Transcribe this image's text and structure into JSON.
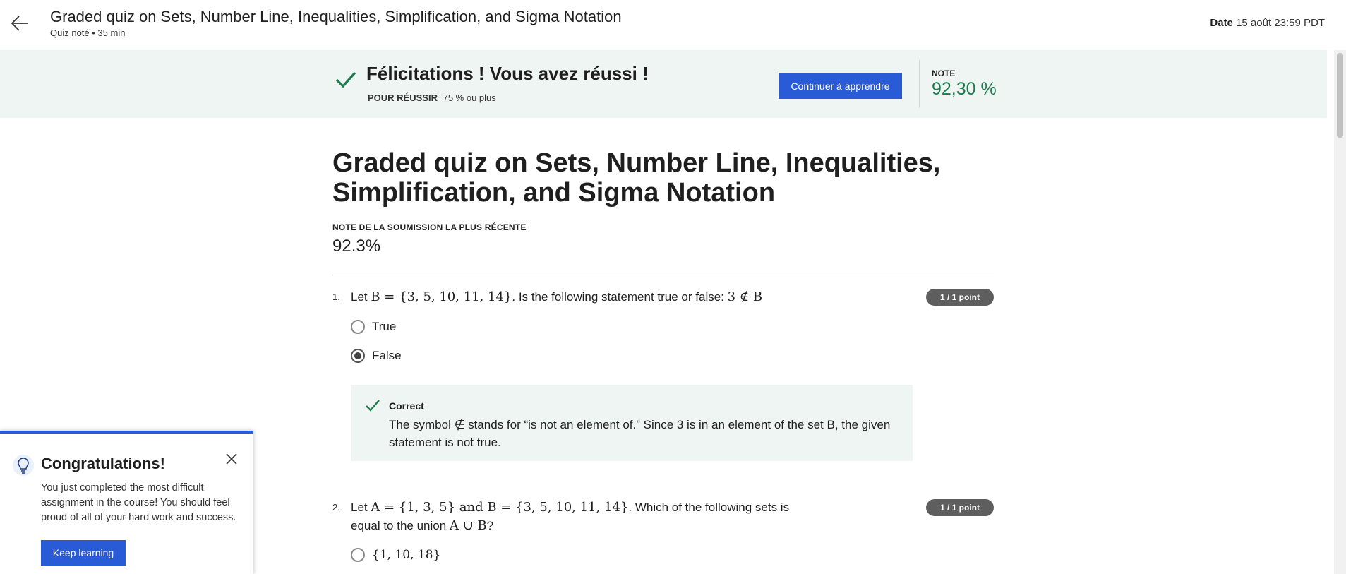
{
  "header": {
    "title": "Graded quiz on Sets, Number Line, Inequalities, Simplification, and Sigma Notation",
    "subtitle": "Quiz noté • 35 min",
    "date_label": "Date",
    "date_value": "15 août 23:59 PDT"
  },
  "banner": {
    "title": "Félicitations ! Vous avez réussi !",
    "pass_label": "POUR RÉUSSIR",
    "pass_value": "75 % ou plus",
    "continue_label": "Continuer à apprendre",
    "note_label": "NOTE",
    "note_value": "92,30 %"
  },
  "main": {
    "title": "Graded quiz on Sets, Number Line, Inequalities, Simplification, and Sigma Notation",
    "recent_label": "NOTE DE LA SOUMISSION LA PLUS RÉCENTE",
    "recent_value": "92.3%"
  },
  "questions": [
    {
      "number": "1.",
      "text_before": "Let ",
      "math_1": "B = {3, 5, 10, 11, 14}",
      "text_middle": ". Is the following statement true or false: ",
      "math_2": "3 ∉ B",
      "points": "1 / 1 point",
      "options": [
        "True",
        "False"
      ],
      "selected": "False",
      "feedback_title": "Correct",
      "feedback_text": "The symbol ∉ stands for “is not an element of.” Since 3 is in an element of the set B, the given statement is not true."
    },
    {
      "number": "2.",
      "text_before": "Let ",
      "math_1": "A = {1, 3, 5} and B = {3, 5, 10, 11, 14}",
      "text_middle": ". Which of the following sets is equal to the union ",
      "math_2": "A ∪ B",
      "text_after": "?",
      "points": "1 / 1 point",
      "options": [
        "{1, 10, 18}"
      ]
    }
  ],
  "popup": {
    "title": "Congratulations!",
    "text": "You just completed the most difficult assignment in the course! You should feel proud of all of your hard work and success.",
    "button_label": "Keep learning"
  },
  "colors": {
    "accent": "#2a5bd7",
    "success": "#1f7a4d",
    "banner_bg": "#eef5f3"
  }
}
